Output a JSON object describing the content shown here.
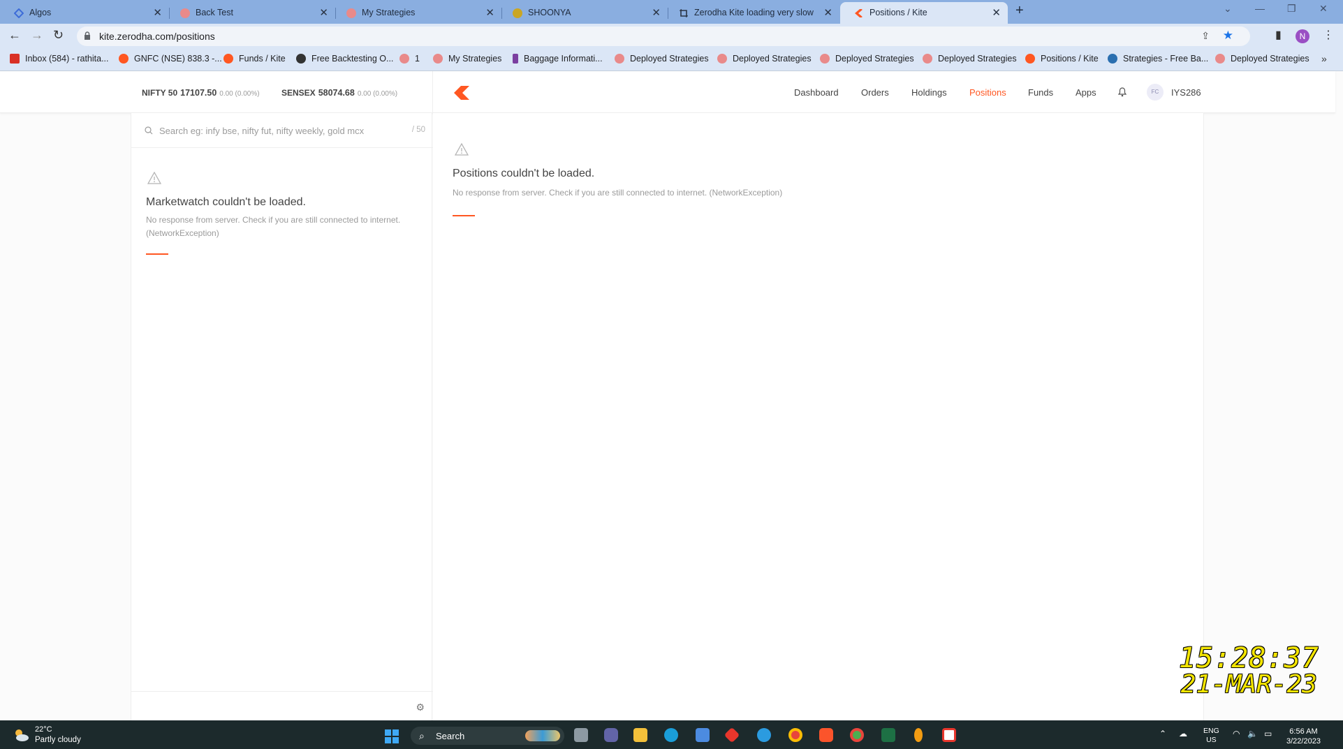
{
  "browser": {
    "tabs": [
      {
        "title": "Algos",
        "favicon": "diamond-icon",
        "color": "#3d6cd8"
      },
      {
        "title": "Back Test",
        "favicon": "circle-icon",
        "color": "#e98a8a"
      },
      {
        "title": "My Strategies",
        "favicon": "circle-icon",
        "color": "#e98a8a"
      },
      {
        "title": "SHOONYA",
        "favicon": "infinity-icon",
        "color": "#caa624"
      },
      {
        "title": "Zerodha Kite loading very slow C",
        "favicon": "crop-icon",
        "color": "#2a3444"
      },
      {
        "title": "Positions / Kite",
        "favicon": "kite-icon",
        "color": "#ff5722"
      }
    ],
    "url": "kite.zerodha.com/positions",
    "profile_initial": "N",
    "bookmarks": [
      {
        "label": "Inbox (584) - rathita...",
        "icon": "gmail-icon",
        "color": "#d93025"
      },
      {
        "label": "GNFC (NSE) 838.3 -...",
        "icon": "kite-icon",
        "color": "#ff5722"
      },
      {
        "label": "Funds / Kite",
        "icon": "kite-icon",
        "color": "#ff5722"
      },
      {
        "label": "Free Backtesting O...",
        "icon": "globe-icon",
        "color": "#333333"
      },
      {
        "label": "1",
        "icon": "circle-icon",
        "color": "#e98a8a"
      },
      {
        "label": "My Strategies",
        "icon": "circle-icon",
        "color": "#e98a8a"
      },
      {
        "label": "Baggage Informati...",
        "icon": "feather-icon",
        "color": "#7b3fa0"
      },
      {
        "label": "Deployed Strategies",
        "icon": "circle-icon",
        "color": "#e98a8a"
      },
      {
        "label": "Deployed Strategies",
        "icon": "circle-icon",
        "color": "#e98a8a"
      },
      {
        "label": "Deployed Strategies",
        "icon": "circle-icon",
        "color": "#e98a8a"
      },
      {
        "label": "Deployed Strategies",
        "icon": "circle-icon",
        "color": "#e98a8a"
      },
      {
        "label": "Positions / Kite",
        "icon": "kite-icon",
        "color": "#ff5722"
      },
      {
        "label": "Strategies - Free Ba...",
        "icon": "chart-icon",
        "color": "#2a6fb0"
      },
      {
        "label": "Deployed Strategies",
        "icon": "circle-icon",
        "color": "#e98a8a"
      }
    ]
  },
  "header": {
    "indices": [
      {
        "name": "NIFTY 50",
        "value": "17107.50",
        "change": "0.00 (0.00%)"
      },
      {
        "name": "SENSEX",
        "value": "58074.68",
        "change": "0.00 (0.00%)"
      }
    ],
    "menu": [
      "Dashboard",
      "Orders",
      "Holdings",
      "Positions",
      "Funds",
      "Apps"
    ],
    "active_menu": "Positions",
    "avatar_initials": "FC",
    "user_id": "IYS286",
    "accent_color": "#ff5722"
  },
  "marketwatch": {
    "search_placeholder": "Search eg: infy bse, nifty fut, nifty weekly, gold mcx",
    "count": "/ 50",
    "error_title": "Marketwatch couldn't be loaded.",
    "error_message": "No response from server. Check if you are still connected to internet. (NetworkException)"
  },
  "positions": {
    "error_title": "Positions couldn't be loaded.",
    "error_message": "No response from server. Check if you are still connected to internet. (NetworkException)"
  },
  "clock_overlay": {
    "time": "15:28:37",
    "date": "21-MAR-23"
  },
  "taskbar": {
    "temperature": "22°C",
    "weather": "Partly cloudy",
    "search_label": "Search",
    "lang_line1": "ENG",
    "lang_line2": "US",
    "time": "6:56 AM",
    "date": "3/22/2023"
  }
}
